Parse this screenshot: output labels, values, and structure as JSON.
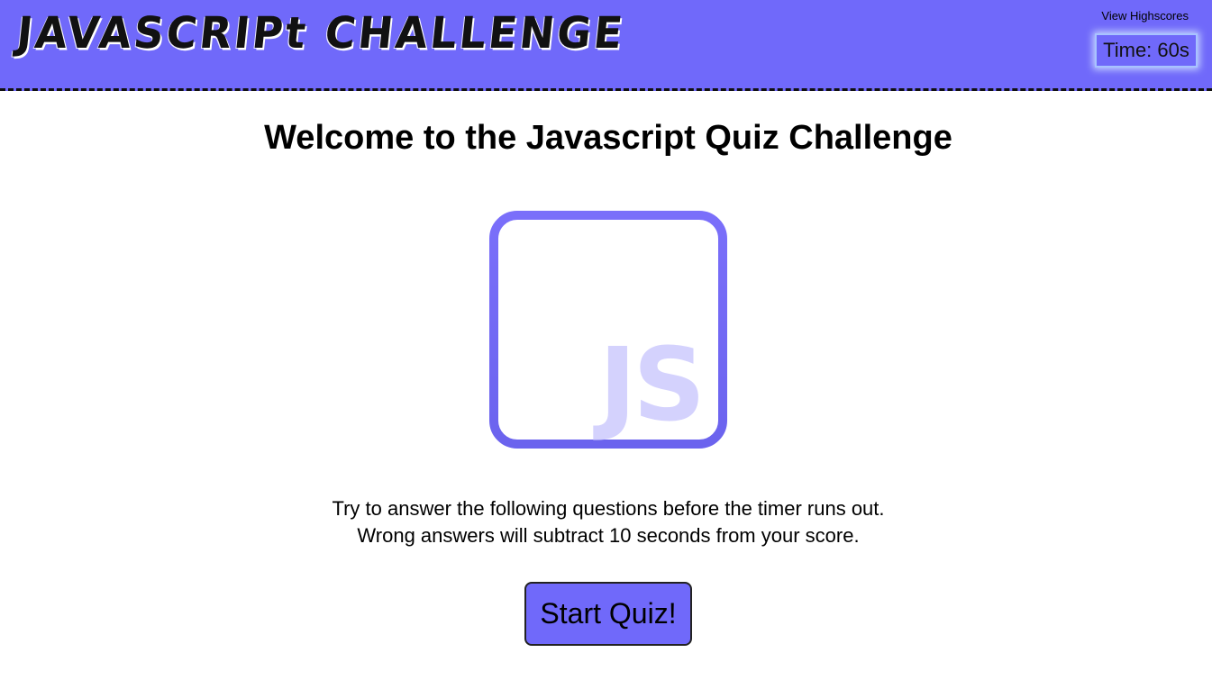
{
  "header": {
    "app_title": "JAVASCRIPt CHALLENGE",
    "highscores_link": "View Highscores",
    "timer_label": "Time: 60s",
    "background_color": "#7069fa"
  },
  "main": {
    "title": "Welcome to the Javascript Quiz Challenge",
    "logo": {
      "icon": "js-logo-icon",
      "text": "JS",
      "frame_color": "#7069fa",
      "text_color": "#d4d2fd"
    },
    "instructions": [
      "Try to answer the following questions before the timer runs out.",
      "Wrong answers will subtract 10 seconds from your score."
    ],
    "start_button_label": "Start Quiz!"
  }
}
